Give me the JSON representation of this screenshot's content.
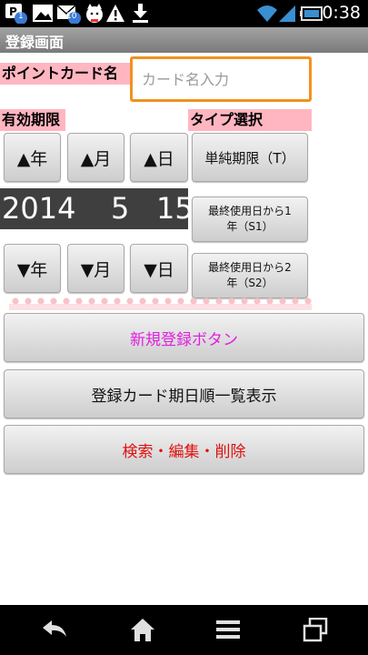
{
  "status_bar": {
    "time": "0:38",
    "badges": [
      "1",
      "10"
    ],
    "icons": [
      "notification-p-icon",
      "image-icon",
      "mail-icon",
      "cat-app-icon",
      "warning-icon",
      "download-icon",
      "wifi-icon",
      "signal-icon",
      "battery-icon"
    ]
  },
  "titlebar": {
    "title": "登録画面"
  },
  "form": {
    "card_name_label": "ポイントカード名",
    "card_name_placeholder": "カード名入力",
    "expiry_label": "有効期限",
    "type_label": "タイプ選択"
  },
  "date_buttons": {
    "year_up": "▲年",
    "month_up": "▲月",
    "day_up": "▲日",
    "year_down": "▼年",
    "month_down": "▼月",
    "day_down": "▼日"
  },
  "date": {
    "year": "2014",
    "month": "5",
    "day": "15"
  },
  "type_buttons": {
    "simple": "単純期限（T）",
    "s1": "最終使用日から1年（S1）",
    "s2": "最終使用日から2年（S2）"
  },
  "actions": {
    "register": "新規登録ボタン",
    "list": "登録カード期日順一覧表示",
    "search": "検索・編集・削除"
  },
  "colors": {
    "label_bg": "#ffb6c1",
    "input_border": "#f0921e",
    "register_text": "#e020e0",
    "search_text": "#e01010",
    "date_bg": "#3f3f3f"
  },
  "nav_icons": [
    "back-icon",
    "home-icon",
    "menu-icon",
    "recent-apps-icon"
  ]
}
